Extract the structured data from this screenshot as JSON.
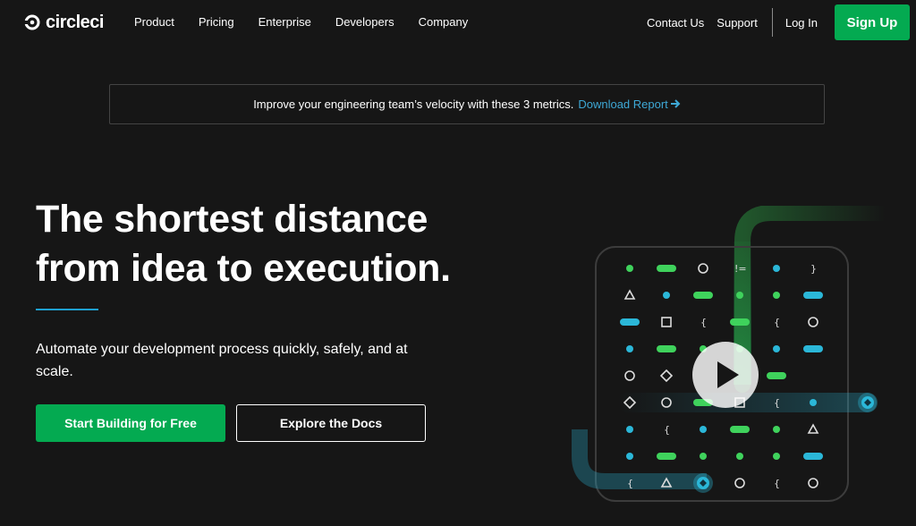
{
  "nav": {
    "logo_text": "circleci",
    "links": [
      "Product",
      "Pricing",
      "Enterprise",
      "Developers",
      "Company"
    ],
    "contact": "Contact Us",
    "support": "Support",
    "login": "Log In",
    "signup": "Sign Up"
  },
  "banner": {
    "text": "Improve your engineering team’s velocity with these 3 metrics.",
    "link": "Download Report"
  },
  "hero": {
    "title": "The shortest distance from idea to execution.",
    "subtitle": "Automate your development process quickly, safely, and at scale.",
    "primary_cta": "Start Building for Free",
    "secondary_cta": "Explore the Docs"
  },
  "colors": {
    "brand_green": "#04aa51",
    "link_blue": "#3ea8d6",
    "background": "#161616"
  },
  "icons": {
    "logo": "circleci-logo-icon",
    "banner_arrow": "arrow-right-icon",
    "video": "play-icon"
  }
}
